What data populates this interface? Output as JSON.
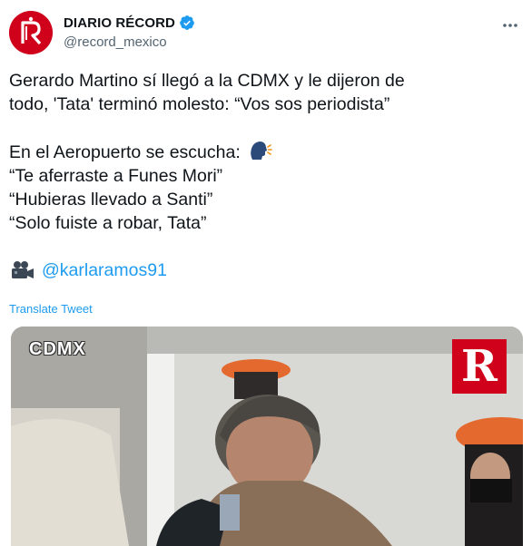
{
  "author": {
    "display_name": "DIARIO RÉCORD",
    "handle": "@record_mexico",
    "verified": true,
    "avatar_icon": "record-logo-icon",
    "brand_color": "#d0021b"
  },
  "tweet": {
    "lines_block_1": [
      "Gerardo Martino sí llegó a la CDMX y le dijeron de",
      "todo, 'Tata' terminó molesto: “Vos sos periodista”"
    ],
    "line_emoji_intro": "En el Aeropuerto se escucha:",
    "quotes": [
      "“Te aferraste a Funes Mori”",
      "“Hubieras llevado a Santi”",
      "“Solo fuiste a robar, Tata”"
    ],
    "mention": "@karlaramos91",
    "emoji_speaking": "speaking-head-icon",
    "emoji_camera": "movie-camera-icon",
    "link_color": "#1d9bf0"
  },
  "translate_label": "Translate Tweet",
  "media": {
    "watermark_text": "CDMX",
    "logo_letter": "R"
  }
}
